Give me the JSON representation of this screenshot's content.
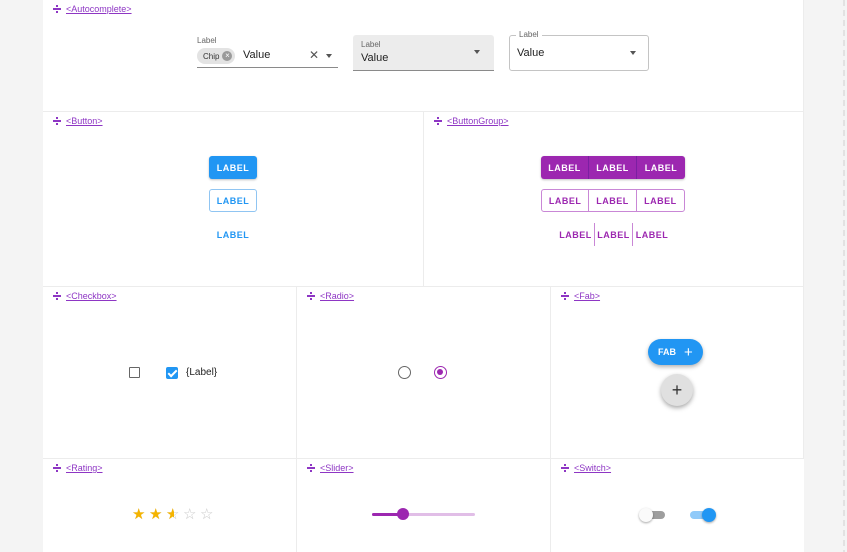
{
  "sections": {
    "autocomplete": "<Autocomplete>",
    "button": "<Button>",
    "button_group": "<ButtonGroup>",
    "checkbox": "<Checkbox>",
    "radio": "<Radio>",
    "fab": "<Fab>",
    "rating": "<Rating>",
    "slider": "<Slider>",
    "switch": "<Switch>"
  },
  "autocomplete": {
    "standard": {
      "label": "Label",
      "chip": "Chip",
      "value": "Value",
      "clear": "✕"
    },
    "filled": {
      "label": "Label",
      "value": "Value"
    },
    "outlined": {
      "label": "Label",
      "value": "Value"
    }
  },
  "buttons": {
    "contained": "LABEL",
    "outlined": "LABEL",
    "text": "LABEL"
  },
  "button_group": {
    "contained": [
      "LABEL",
      "LABEL",
      "LABEL"
    ],
    "outlined": [
      "LABEL",
      "LABEL",
      "LABEL"
    ],
    "text": [
      "LABEL",
      "LABEL",
      "LABEL"
    ]
  },
  "checkbox": {
    "label": "{Label}",
    "unchecked": false,
    "checked": true
  },
  "radio": {
    "unchecked": false,
    "checked": true
  },
  "fab": {
    "extended_label": "FAB",
    "plus": "+",
    "round_plus": "+"
  },
  "rating": {
    "value": 2.5,
    "max": 5
  },
  "slider": {
    "value": 0.3
  },
  "switch": {
    "off": false,
    "on": true
  },
  "colors": {
    "primary": "#2196f3",
    "secondary": "#9c27b0",
    "star": "#f5b400"
  }
}
